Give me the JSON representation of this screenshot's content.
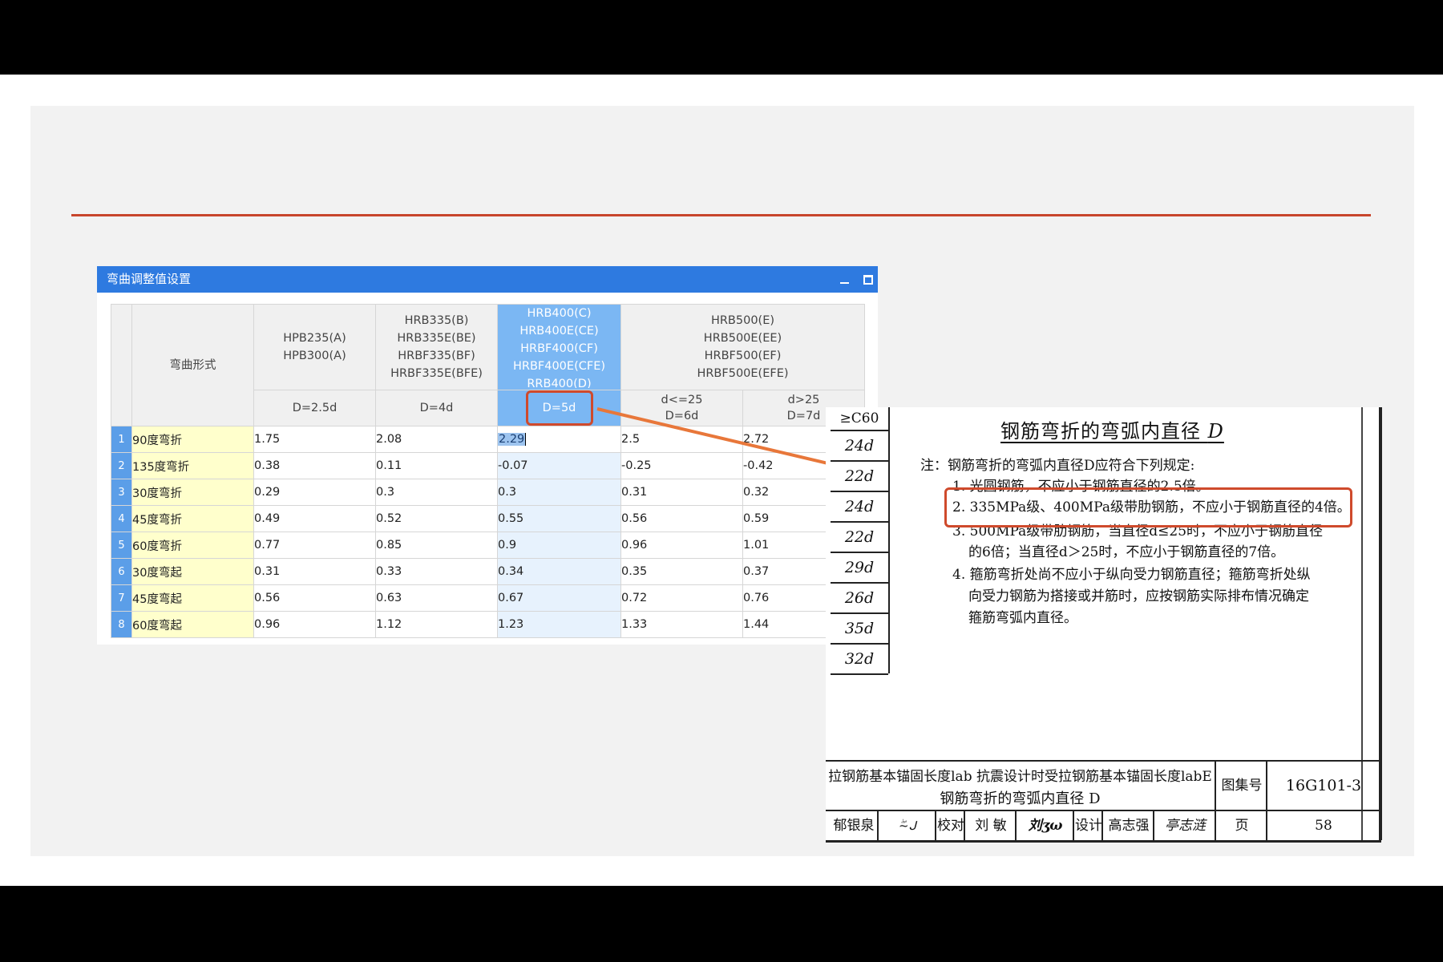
{
  "dialog": {
    "title": "弯曲调整值设置",
    "corner_header": "弯曲形式",
    "groups": [
      {
        "lines": [
          "HPB235(A)",
          "HPB300(A)"
        ],
        "sub": "D=2.5d"
      },
      {
        "lines": [
          "HRB335(B)",
          "HRB335E(BE)",
          "HRBF335(BF)",
          "HRBF335E(BFE)"
        ],
        "sub": "D=4d"
      },
      {
        "lines": [
          "HRB400(C)",
          "HRB400E(CE)",
          "HRBF400(CF)",
          "HRBF400E(CFE)",
          "RRB400(D)"
        ],
        "sub": "D=5d"
      },
      {
        "lines": [
          "HRB500(E)",
          "HRB500E(EE)",
          "HRBF500(EF)",
          "HRBF500E(EFE)"
        ],
        "subs": [
          [
            "d<=25",
            "D=6d"
          ],
          [
            "d>25",
            "D=7d"
          ]
        ]
      }
    ],
    "rows": [
      {
        "no": "1",
        "name": "90度弯折",
        "values": [
          "1.75",
          "2.08",
          "2.29",
          "2.5",
          "2.72"
        ]
      },
      {
        "no": "2",
        "name": "135度弯折",
        "values": [
          "0.38",
          "0.11",
          "-0.07",
          "-0.25",
          "-0.42"
        ]
      },
      {
        "no": "3",
        "name": "30度弯折",
        "values": [
          "0.29",
          "0.3",
          "0.3",
          "0.31",
          "0.32"
        ]
      },
      {
        "no": "4",
        "name": "45度弯折",
        "values": [
          "0.49",
          "0.52",
          "0.55",
          "0.56",
          "0.59"
        ]
      },
      {
        "no": "5",
        "name": "60度弯折",
        "values": [
          "0.77",
          "0.85",
          "0.9",
          "0.96",
          "1.01"
        ]
      },
      {
        "no": "6",
        "name": "30度弯起",
        "values": [
          "0.31",
          "0.33",
          "0.34",
          "0.35",
          "0.37"
        ]
      },
      {
        "no": "7",
        "name": "45度弯起",
        "values": [
          "0.56",
          "0.63",
          "0.67",
          "0.72",
          "0.76"
        ]
      },
      {
        "no": "8",
        "name": "60度弯起",
        "values": [
          "0.96",
          "1.12",
          "1.23",
          "1.33",
          "1.44"
        ]
      }
    ]
  },
  "doc": {
    "left_col": [
      "≥C60",
      "24d",
      "22d",
      "24d",
      "22d",
      "29d",
      "26d",
      "35d",
      "32d"
    ],
    "title_main": "钢筋弯折的弯弧内直径",
    "title_var": "D",
    "notes": [
      "注：钢筋弯折的弯弧内直径D应符合下列规定:",
      "1. 光圆钢筋，不应小于钢筋直径的2.5倍。",
      "2. 335MPa级、400MPa级带肋钢筋，不应小于钢筋直径的4倍。",
      "3. 500MPa级带肋钢筋，当直径d≤25时，不应小于钢筋直径",
      "的6倍；当直径d＞25时，不应小于钢筋直径的7倍。",
      "4. 箍筋弯折处尚不应小于纵向受力钢筋直径；箍筋弯折处纵",
      "向受力钢筋为搭接或并筋时，应按钢筋实际排布情况确定",
      "箍筋弯弧内直径。"
    ],
    "footer": {
      "caption_line1": "拉钢筋基本锚固长度lab 抗震设计时受拉钢筋基本锚固长度labE",
      "caption_line2": "钢筋弯折的弯弧内直径 D",
      "atlas_label": "图集号",
      "atlas_no": "16G101-3",
      "reviewer": "郁银泉",
      "check_label": "校对",
      "checker": "刘  敏",
      "design_label": "设计",
      "designer": "高志强",
      "page_label": "页",
      "page_no": "58"
    }
  },
  "colors": {
    "accent_line": "#c8452c",
    "title_bar": "#2e7ae0",
    "highlight_box": "#cf4a2c",
    "arrow": "#e8773a"
  }
}
